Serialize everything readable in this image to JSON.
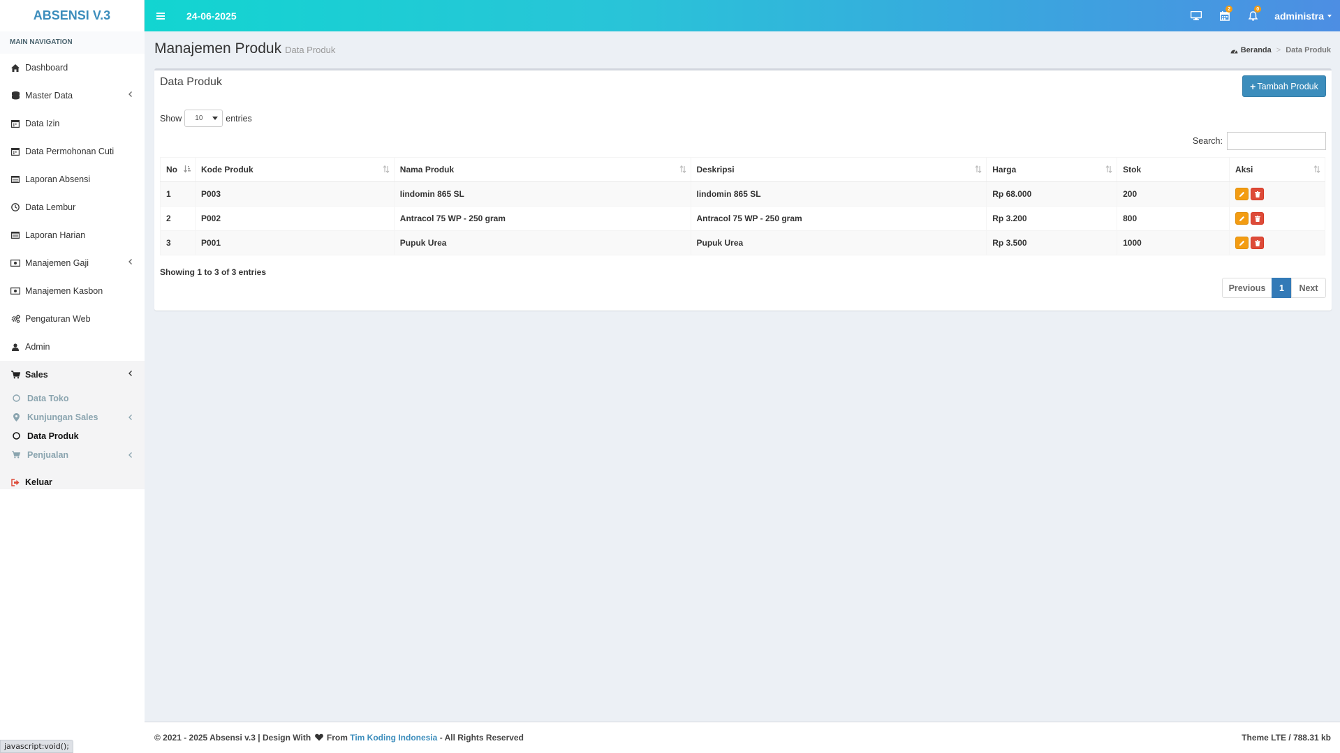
{
  "app": {
    "logo": "ABSENSI V.3"
  },
  "header": {
    "date": "24-06-2025",
    "calendar_badge": "2",
    "bell_badge": "0",
    "user": "administra"
  },
  "sidebar": {
    "section": "MAIN NAVIGATION",
    "items": [
      {
        "label": "Dashboard",
        "icon": "home-icon"
      },
      {
        "label": "Master Data",
        "icon": "database-icon"
      },
      {
        "label": "Data Izin",
        "icon": "calendar-icon"
      },
      {
        "label": "Data Permohonan Cuti",
        "icon": "calendar-icon"
      },
      {
        "label": "Laporan Absensi",
        "icon": "list-icon"
      },
      {
        "label": "Data Lembur",
        "icon": "clock-icon"
      },
      {
        "label": "Laporan Harian",
        "icon": "list-icon"
      },
      {
        "label": "Manajemen Gaji",
        "icon": "money-icon"
      },
      {
        "label": "Manajemen Kasbon",
        "icon": "money-icon"
      },
      {
        "label": "Pengaturan Web",
        "icon": "cogs-icon"
      },
      {
        "label": "Admin",
        "icon": "user-icon"
      },
      {
        "label": "Sales",
        "icon": "cart-icon"
      }
    ],
    "sales_sub": [
      {
        "label": "Data Toko"
      },
      {
        "label": "Kunjungan Sales"
      },
      {
        "label": "Data Produk"
      },
      {
        "label": "Penjualan"
      }
    ],
    "logout": "Keluar"
  },
  "page": {
    "title": "Manajemen Produk",
    "subtitle": "Data Produk",
    "breadcrumb_home": "Beranda",
    "breadcrumb_sep": ">",
    "breadcrumb_current": "Data Produk"
  },
  "box": {
    "title": "Data Produk",
    "add_button": "Tambah Produk",
    "show_label": "Show",
    "entries_label": "entries",
    "page_length": "10",
    "search_label": "Search:",
    "search_value": ""
  },
  "table": {
    "headers": [
      "No",
      "Kode Produk",
      "Nama Produk",
      "Deskripsi",
      "Harga",
      "Stok",
      "Aksi"
    ],
    "rows": [
      [
        "1",
        "P003",
        "Iindomin 865 SL",
        "Iindomin 865 SL",
        "Rp 68.000",
        "200"
      ],
      [
        "2",
        "P002",
        "Antracol 75 WP - 250 gram",
        "Antracol 75 WP - 250 gram",
        "Rp 3.200",
        "800"
      ],
      [
        "3",
        "P001",
        "Pupuk Urea",
        "Pupuk Urea",
        "Rp 3.500",
        "1000"
      ]
    ]
  },
  "pagination": {
    "info": "Showing 1 to 3 of 3 entries",
    "prev": "Previous",
    "current": "1",
    "next": "Next"
  },
  "footer": {
    "left_prefix": "© 2021 - 2025 Absensi v.3 | Design With",
    "left_from": "From",
    "link": "Tim Koding Indonesia",
    "left_suffix": "- All Rights Reserved",
    "right": "Theme LTE / 788.31 kb"
  },
  "statusbar": {
    "text": "javascript:void();"
  },
  "colors": {
    "primary": "#3c8dbc",
    "warning": "#f39c12",
    "danger": "#dd4b39",
    "header_gradient_start": "#12d5d1",
    "header_gradient_end": "#4d8ee3"
  }
}
